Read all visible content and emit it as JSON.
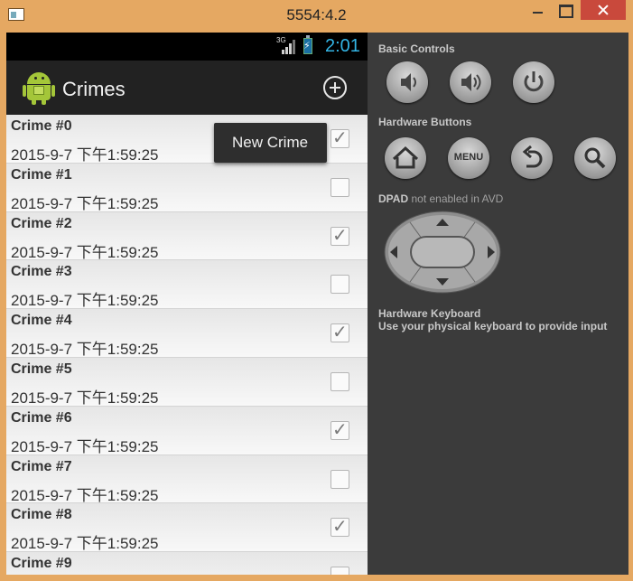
{
  "window": {
    "title": "5554:4.2"
  },
  "phone": {
    "status": {
      "network": "3G",
      "time": "2:01"
    },
    "action_bar": {
      "title": "Crimes"
    },
    "popup_menu": {
      "item": "New Crime"
    },
    "crimes": [
      {
        "title": "Crime #0",
        "date": "2015-9-7 下午1:59:25",
        "solved": true
      },
      {
        "title": "Crime #1",
        "date": "2015-9-7 下午1:59:25",
        "solved": false
      },
      {
        "title": "Crime #2",
        "date": "2015-9-7 下午1:59:25",
        "solved": true
      },
      {
        "title": "Crime #3",
        "date": "2015-9-7 下午1:59:25",
        "solved": false
      },
      {
        "title": "Crime #4",
        "date": "2015-9-7 下午1:59:25",
        "solved": true
      },
      {
        "title": "Crime #5",
        "date": "2015-9-7 下午1:59:25",
        "solved": false
      },
      {
        "title": "Crime #6",
        "date": "2015-9-7 下午1:59:25",
        "solved": true
      },
      {
        "title": "Crime #7",
        "date": "2015-9-7 下午1:59:25",
        "solved": false
      },
      {
        "title": "Crime #8",
        "date": "2015-9-7 下午1:59:25",
        "solved": true
      },
      {
        "title": "Crime #9",
        "date": "",
        "solved": false
      }
    ]
  },
  "panel": {
    "basic_controls_label": "Basic Controls",
    "hardware_buttons_label": "Hardware Buttons",
    "menu_button_label": "MENU",
    "dpad_label": "DPAD",
    "dpad_note": "not enabled in AVD",
    "keyboard_title": "Hardware Keyboard",
    "keyboard_note": "Use your physical keyboard to provide input"
  },
  "colors": {
    "window_frame": "#e5a862",
    "close_button": "#c9493c",
    "clock_blue": "#33b5e5",
    "android_green": "#a4c639",
    "panel_bg": "#3b3b3b"
  }
}
